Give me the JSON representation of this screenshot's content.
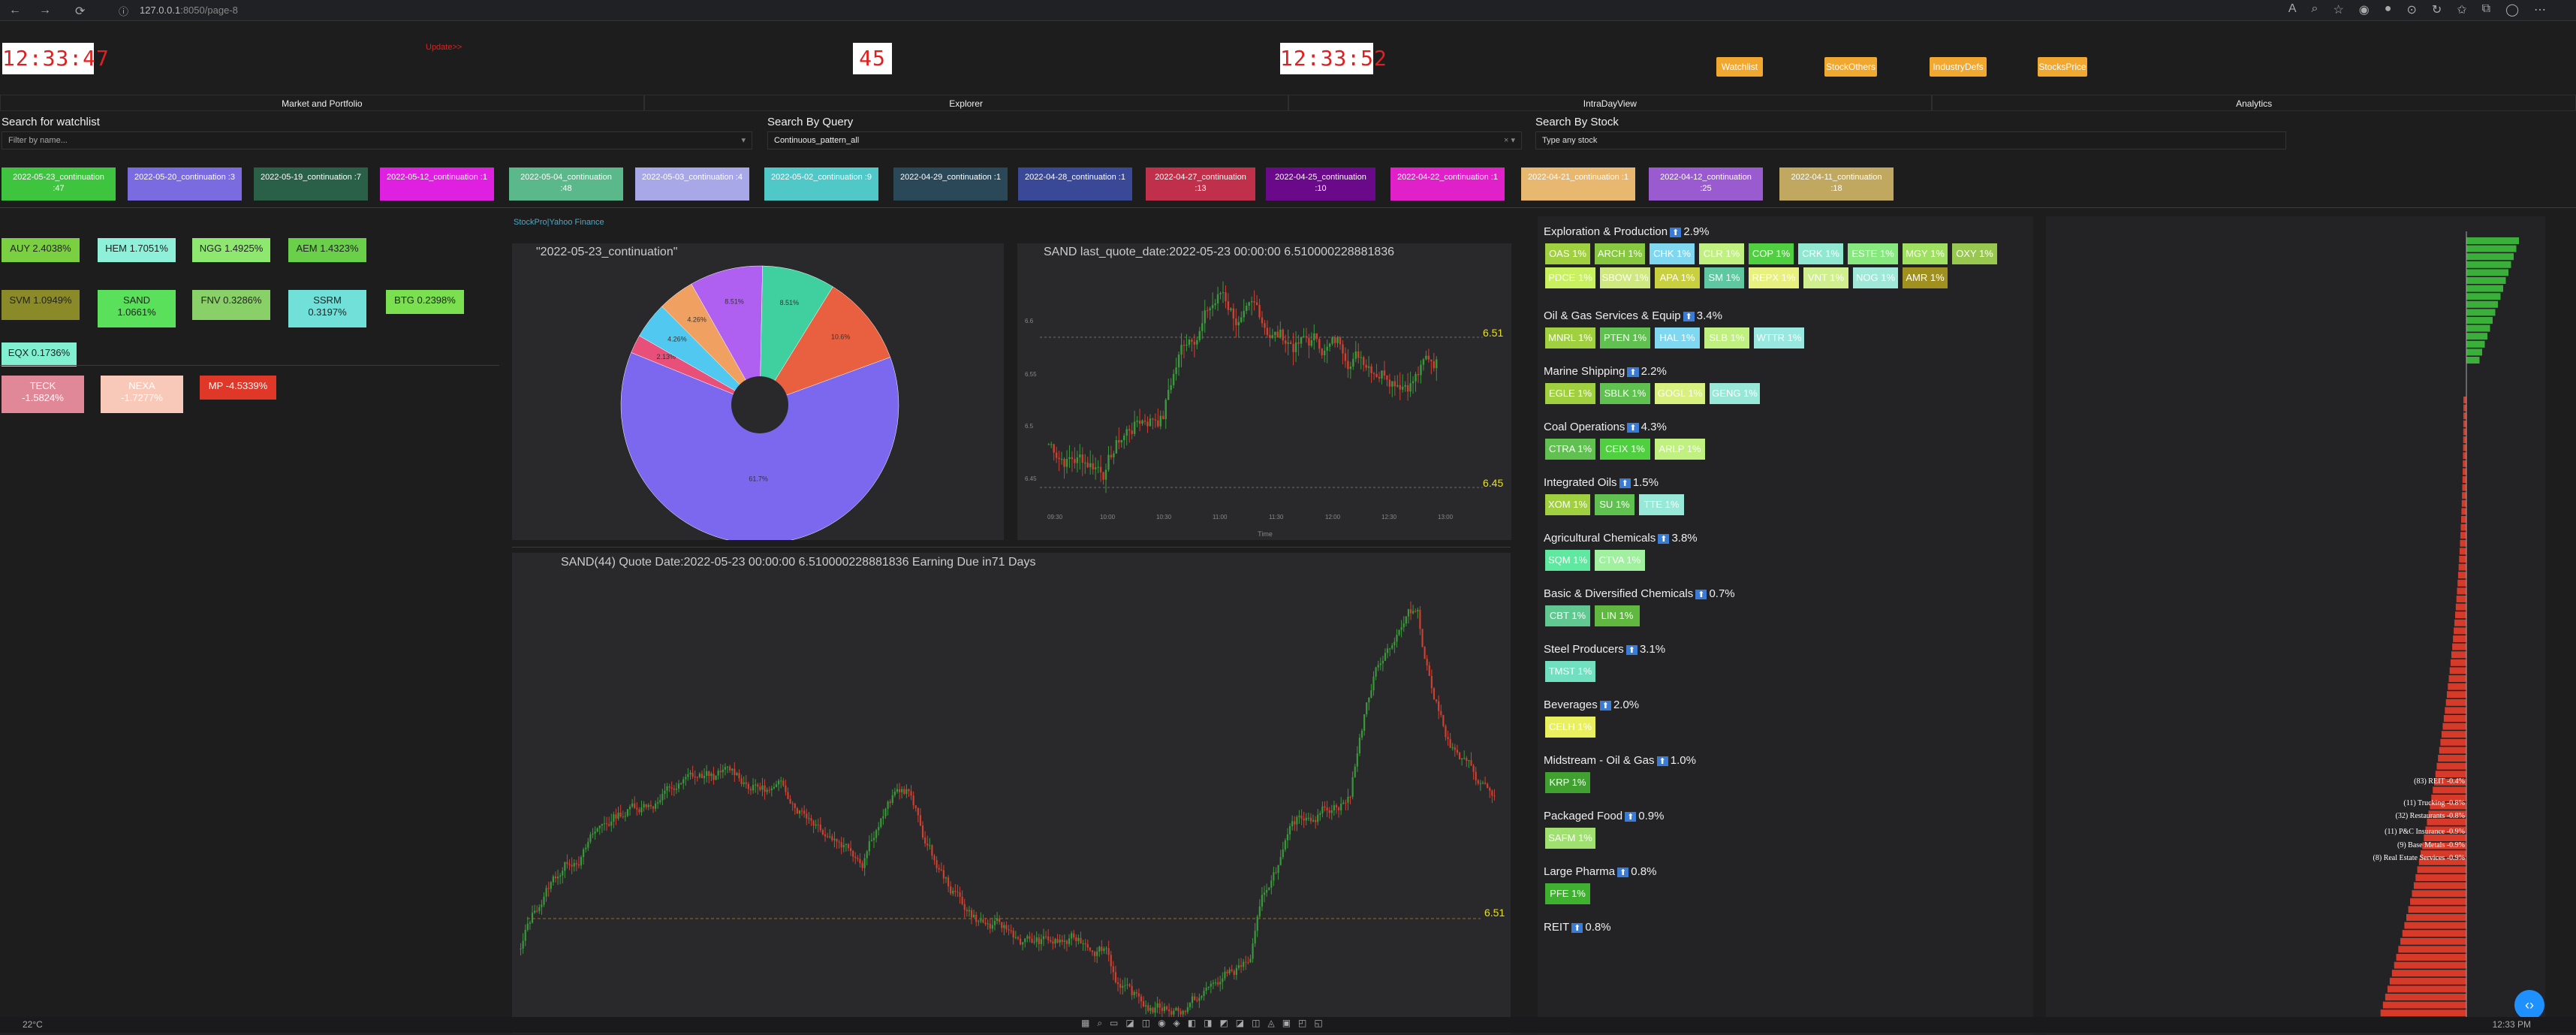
{
  "browser": {
    "host": "127.0.0.1",
    "port": ":8050",
    "path": "/page-8"
  },
  "clock1": "12:33:47",
  "clock2": "45",
  "clock3": "12:33:52",
  "update_link": "Update>>",
  "top_buttons": [
    "Watchlist",
    "StockOthers",
    "IndustryDefs",
    "StocksPrice"
  ],
  "tabs": [
    "Market and Portfolio",
    "Explorer",
    "IntraDayView",
    "Analytics"
  ],
  "search": {
    "watchlist": {
      "label": "Search for watchlist",
      "placeholder": "Filter by name..."
    },
    "query": {
      "label": "Search By Query",
      "value": "Continuous_pattern_all"
    },
    "stock": {
      "label": "Search By Stock",
      "placeholder": "Type any stock"
    }
  },
  "chips": [
    {
      "l1": "2022-05-23_continuation",
      "l2": ":47",
      "c": "#3ec43e"
    },
    {
      "l1": "2022-05-20_continuation :3",
      "l2": "",
      "c": "#7b6be0"
    },
    {
      "l1": "2022-05-19_continuation :7",
      "l2": "",
      "c": "#2a6048"
    },
    {
      "l1": "2022-05-12_continuation :1",
      "l2": "",
      "c": "#e020e0"
    },
    {
      "l1": "2022-05-04_continuation",
      "l2": ":48",
      "c": "#5ab88a"
    },
    {
      "l1": "2022-05-03_continuation :4",
      "l2": "",
      "c": "#a8a8e8"
    },
    {
      "l1": "2022-05-02_continuation :9",
      "l2": "",
      "c": "#50c8c8"
    },
    {
      "l1": "2022-04-29_continuation :1",
      "l2": "",
      "c": "#2a4858"
    },
    {
      "l1": "2022-04-28_continuation :1",
      "l2": "",
      "c": "#3a4898"
    },
    {
      "l1": "2022-04-27_continuation",
      "l2": ":13",
      "c": "#c0304a"
    },
    {
      "l1": "2022-04-25_continuation",
      "l2": ":10",
      "c": "#6a0a8a"
    },
    {
      "l1": "2022-04-22_continuation :1",
      "l2": "",
      "c": "#e020c8"
    },
    {
      "l1": "2022-04-21_continuation :1",
      "l2": "",
      "c": "#e8b870"
    },
    {
      "l1": "2022-04-12_continuation",
      "l2": ":25",
      "c": "#9a5ad0"
    },
    {
      "l1": "2022-04-11_continuation",
      "l2": ":18",
      "c": "#c0a860"
    }
  ],
  "gainers": [
    {
      "t": "AUY 2.4038%",
      "c": "#7ad040"
    },
    {
      "t": "HEM 1.7051%",
      "c": "#8ef0d8"
    },
    {
      "t": "NGG 1.4925%",
      "c": "#8ee870"
    },
    {
      "t": "AEM 1.4323%",
      "c": "#6ad04a"
    },
    {
      "t": "SVM 1.0949%",
      "c": "#8a8a28"
    },
    {
      "t": "SAND\n1.0661%",
      "c": "#5ae05a"
    },
    {
      "t": "FNV 0.3286%",
      "c": "#8ad068"
    },
    {
      "t": "SSRM\n0.3197%",
      "c": "#70e0d8"
    },
    {
      "t": "BTG 0.2398%",
      "c": "#7ae050"
    },
    {
      "t": "EQX 0.1736%",
      "c": "#80f0d0"
    }
  ],
  "losers": [
    {
      "t": "TECK\n-1.5824%",
      "c": "#e08898"
    },
    {
      "t": "NEXA\n-1.7277%",
      "c": "#f8c8b8"
    },
    {
      "t": "MP -4.5339%",
      "c": "#e03828"
    }
  ],
  "source_links": "StockPro|Yahoo Finance",
  "pie": {
    "title": "\"2022-05-23_continuation\""
  },
  "chart_data": [
    {
      "type": "pie",
      "title": "\"2022-05-23_continuation\"",
      "slices": [
        {
          "value": 61.7,
          "color": "#7b68ee"
        },
        {
          "value": 2.13,
          "color": "#e8507a"
        },
        {
          "value": 4.26,
          "color": "#50c8f0"
        },
        {
          "value": 4.26,
          "color": "#f0a060"
        },
        {
          "value": 8.51,
          "color": "#b060f0"
        },
        {
          "value": 8.51,
          "color": "#40d0a0"
        },
        {
          "value": 10.6,
          "color": "#e86040"
        }
      ],
      "labels": [
        "61.7%",
        "2.13%",
        "4.26%",
        "4.26%",
        "8.51%",
        "8.51%",
        "10.6%"
      ]
    },
    {
      "type": "line",
      "title": "SAND last_quote_date:2022-05-23 00:00:00 6.510000228881836",
      "xlabel": "Time",
      "ticks_x": [
        "09:30\nMay 23, 2022",
        "10:00",
        "10:30",
        "11:00",
        "11:30",
        "12:00",
        "12:30",
        "13:00"
      ],
      "ticks_y": [
        "6.6",
        "6.55",
        "6.5",
        "6.45"
      ],
      "markers": [
        "6.51",
        "6.45"
      ]
    },
    {
      "type": "line",
      "title": "SAND(44) Quote Date:2022-05-23 00:00:00 6.510000228881836 Earning Due in71 Days",
      "marker": "6.51"
    }
  ],
  "industries": [
    {
      "name": "Exploration & Production",
      "pct": "2.9%",
      "tickers": [
        [
          "OAS 1%",
          "#a0d040"
        ],
        [
          "ARCH 1%",
          "#88c840"
        ],
        [
          "CHK 1%",
          "#80d8f0"
        ],
        [
          "CLR 1%",
          "#c0f080"
        ],
        [
          "COP 1%",
          "#50d040"
        ],
        [
          "CRK 1%",
          "#90e8d0"
        ],
        [
          "ESTE 1%",
          "#88e880"
        ],
        [
          "MGY 1%",
          "#a0e060"
        ],
        [
          "OXY 1%",
          "#98c850"
        ],
        [
          "PDCE 1%",
          "#c8f060"
        ],
        [
          "SBOW 1%",
          "#d0e880"
        ],
        [
          "APA 1%",
          "#c8d040"
        ],
        [
          "SM 1%",
          "#60c8a0"
        ],
        [
          "REPX 1%",
          "#e8f080"
        ],
        [
          "VNT 1%",
          "#d0f090"
        ],
        [
          "NOG 1%",
          "#a0e8d8"
        ],
        [
          "AMR 1%",
          "#a09020"
        ]
      ]
    },
    {
      "name": "Oil & Gas Services & Equip",
      "pct": "3.4%",
      "tickers": [
        [
          "MNRL 1%",
          "#a0d040"
        ],
        [
          "PTEN 1%",
          "#60c050"
        ],
        [
          "HAL 1%",
          "#80d8f0"
        ],
        [
          "SLB 1%",
          "#c0f080"
        ],
        [
          "WTTR 1%",
          "#98e8e0"
        ]
      ]
    },
    {
      "name": "Marine Shipping",
      "pct": "2.2%",
      "tickers": [
        [
          "EGLE 1%",
          "#a0d040"
        ],
        [
          "SBLK 1%",
          "#60c050"
        ],
        [
          "GOGL 1%",
          "#d8f080"
        ],
        [
          "GENG 1%",
          "#98e8d8"
        ]
      ]
    },
    {
      "name": "Coal Operations",
      "pct": "4.3%",
      "tickers": [
        [
          "CTRA 1%",
          "#60c050"
        ],
        [
          "CEIX 1%",
          "#50d040"
        ],
        [
          "ARLP 1%",
          "#c0f080"
        ]
      ]
    },
    {
      "name": "Integrated Oils",
      "pct": "1.5%",
      "tickers": [
        [
          "XOM 1%",
          "#a0d040"
        ],
        [
          "SU 1%",
          "#60c050"
        ],
        [
          "TTE 1%",
          "#98e8d8"
        ]
      ]
    },
    {
      "name": "Agricultural Chemicals",
      "pct": "3.8%",
      "tickers": [
        [
          "SQM 1%",
          "#60e8a0"
        ],
        [
          "CTVA 1%",
          "#a0f0a0"
        ]
      ]
    },
    {
      "name": "Basic & Diversified Chemicals",
      "pct": "0.7%",
      "tickers": [
        [
          "CBT 1%",
          "#60c890"
        ],
        [
          "LIN 1%",
          "#60b840"
        ]
      ]
    },
    {
      "name": "Steel Producers",
      "pct": "3.1%",
      "tickers": [
        [
          "TMST 1%",
          "#70e0c0"
        ]
      ]
    },
    {
      "name": "Beverages",
      "pct": "2.0%",
      "tickers": [
        [
          "CELH 1%",
          "#e8f060"
        ]
      ]
    },
    {
      "name": "Midstream - Oil & Gas",
      "pct": "1.0%",
      "tickers": [
        [
          "KRP 1%",
          "#40a030"
        ]
      ]
    },
    {
      "name": "Packaged Food",
      "pct": "0.9%",
      "tickers": [
        [
          "SAFM 1%",
          "#a0e070"
        ]
      ]
    },
    {
      "name": "Large Pharma",
      "pct": "0.8%",
      "tickers": [
        [
          "PFE 1%",
          "#40b030"
        ]
      ]
    },
    {
      "name": "REIT",
      "pct": "0.8%",
      "tickers": []
    }
  ],
  "sidebar_labels": [
    "(83) REIT -0.4%",
    "(11) Trucking -0.8%",
    "(32) Restaurants -0.8%",
    "(11) P&C Insurance -0.9%",
    "(9) Base Metals -0.9%",
    "(8) Real Estate Services -0.9%"
  ],
  "taskbar": {
    "temp": "22°C",
    "time": "12:33 PM"
  }
}
